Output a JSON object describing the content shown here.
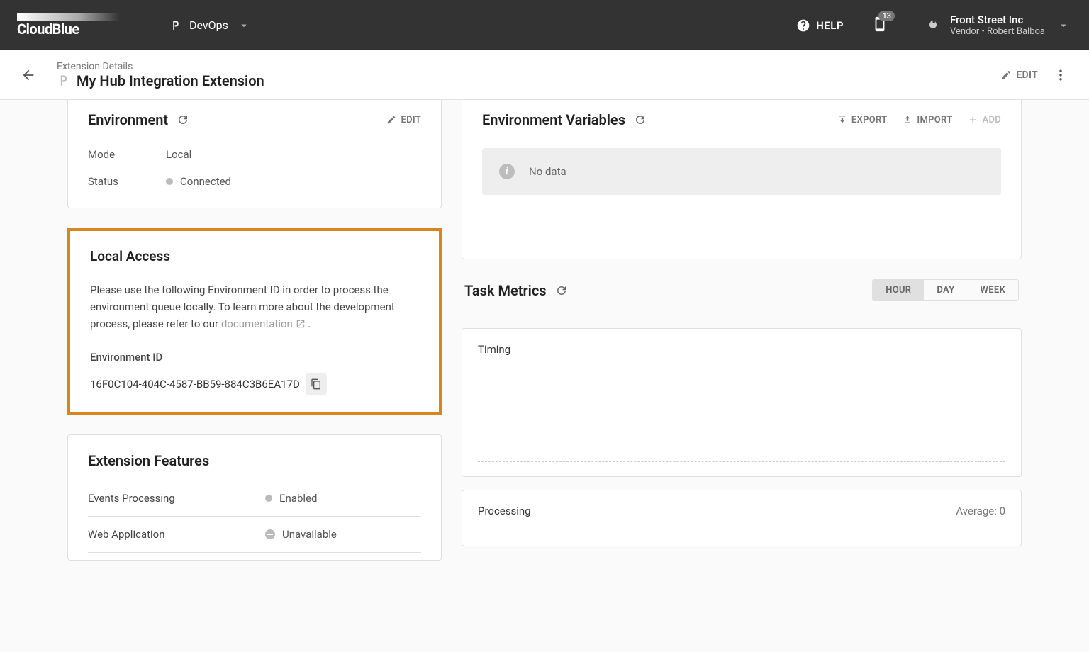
{
  "topbar": {
    "brand": "CloudBlue",
    "module": "DevOps",
    "help": "HELP",
    "notif_count": "13",
    "company_name": "Front Street Inc",
    "company_sub": "Vendor • Robert Balboa"
  },
  "header": {
    "breadcrumb": "Extension Details",
    "title": "My Hub Integration Extension",
    "edit": "EDIT"
  },
  "env_card": {
    "title": "Environment",
    "edit": "EDIT",
    "mode_label": "Mode",
    "mode_value": "Local",
    "status_label": "Status",
    "status_value": "Connected"
  },
  "local_access": {
    "title": "Local Access",
    "desc_pre": "Please use the following Environment ID in order to process the environment queue locally. To learn more about the development process, please refer to our ",
    "doc_link": "documentation",
    "desc_post": " .",
    "env_id_label": "Environment ID",
    "env_id_value": "16F0C104-404C-4587-BB59-884C3B6EA17D"
  },
  "features": {
    "title": "Extension Features",
    "rows": [
      {
        "name": "Events Processing",
        "status": "Enabled",
        "dot": "solid"
      },
      {
        "name": "Web Application",
        "status": "Unavailable",
        "dot": "dash"
      }
    ]
  },
  "env_vars": {
    "title": "Environment Variables",
    "export": "EXPORT",
    "import": "IMPORT",
    "add": "ADD",
    "no_data": "No data"
  },
  "metrics": {
    "title": "Task Metrics",
    "seg": {
      "hour": "HOUR",
      "day": "DAY",
      "week": "WEEK"
    },
    "timing_title": "Timing",
    "processing_title": "Processing",
    "processing_avg": "Average: 0"
  }
}
